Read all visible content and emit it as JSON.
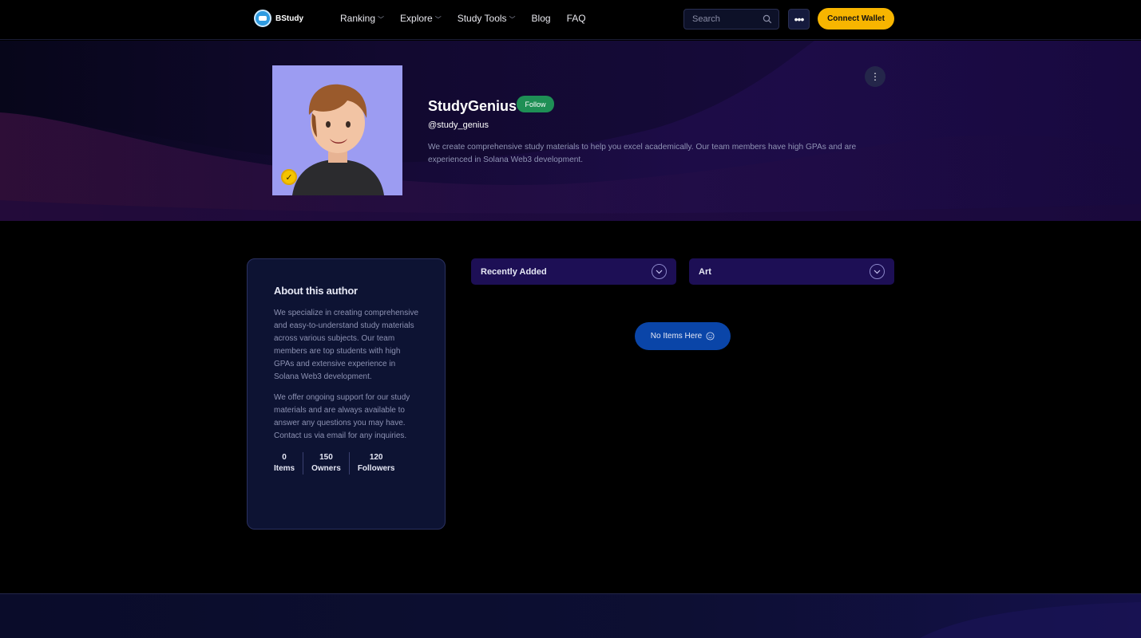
{
  "brand": {
    "name": "BStudy"
  },
  "nav": {
    "links": [
      {
        "label": "Ranking",
        "has_dropdown": true
      },
      {
        "label": "Explore",
        "has_dropdown": true
      },
      {
        "label": "Study Tools",
        "has_dropdown": true
      },
      {
        "label": "Blog",
        "has_dropdown": false
      },
      {
        "label": "FAQ",
        "has_dropdown": false
      }
    ],
    "search_placeholder": "Search",
    "more_label": "•••",
    "wallet_label": "Connect Wallet"
  },
  "profile": {
    "name": "StudyGenius",
    "follow_label": "Follow",
    "handle": "@study_genius",
    "bio": "We create comprehensive study materials to help you excel academically. Our team members have high GPAs and are experienced in Solana Web3 development.",
    "verified_mark": "✓",
    "menu_label": "⋮"
  },
  "about": {
    "title": "About this author",
    "paragraphs": [
      "We specialize in creating comprehensive and easy-to-understand study materials across various subjects. Our team members are top students with high GPAs and extensive experience in Solana Web3 development.",
      "We offer ongoing support for our study materials and are always available to answer any questions you may have. Contact us via email for any inquiries."
    ],
    "stats": [
      {
        "value": "0",
        "label": "Items"
      },
      {
        "value": "150",
        "label": "Owners"
      },
      {
        "value": "120",
        "label": "Followers"
      }
    ]
  },
  "filters": {
    "sort": "Recently Added",
    "category": "Art"
  },
  "empty_state": {
    "label": "No Items Here"
  },
  "colors": {
    "accent": "#f7b500",
    "follow": "#1e8f55",
    "empty_button": "#0a45a8",
    "filter_bg": "#1d0f55"
  }
}
